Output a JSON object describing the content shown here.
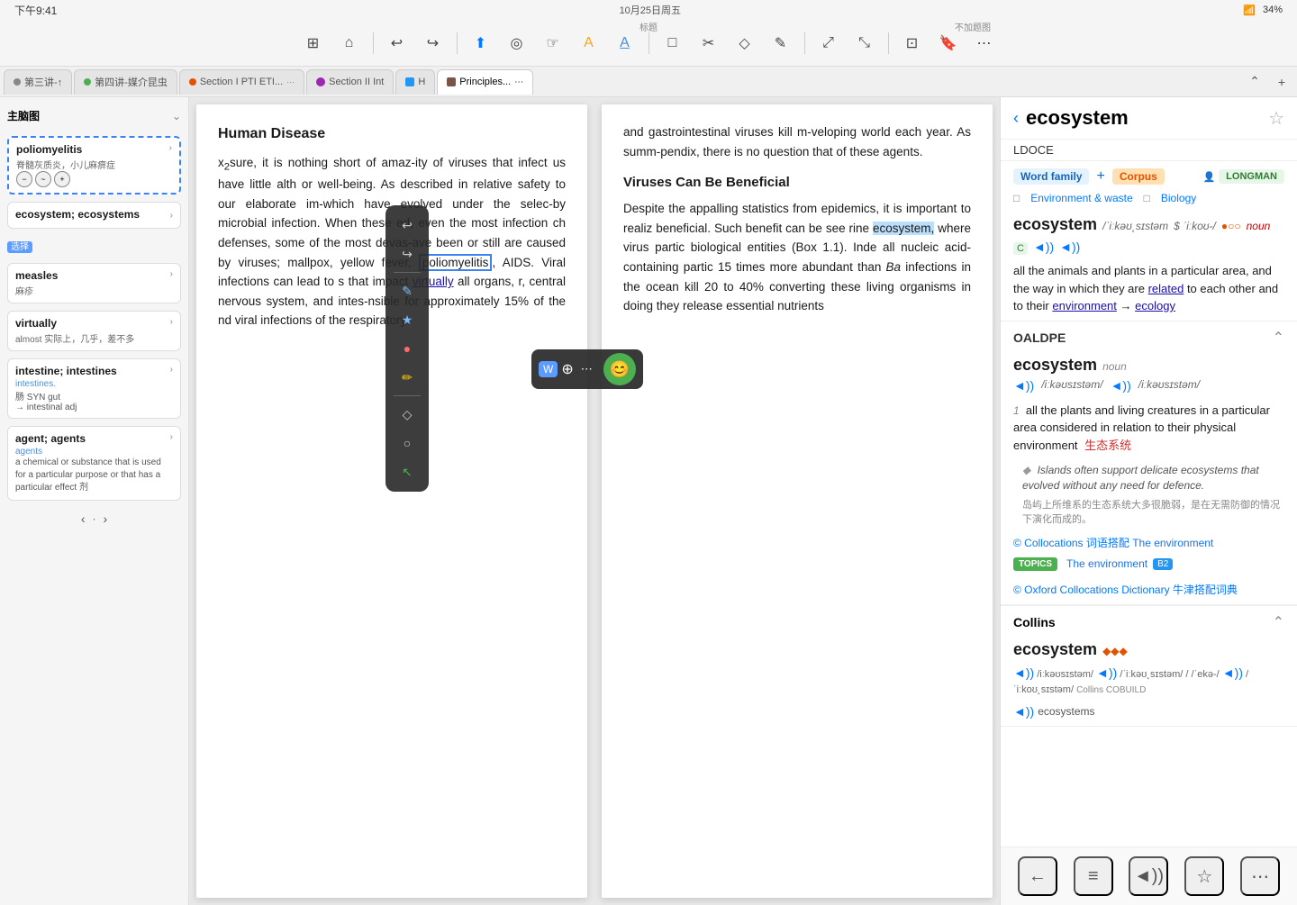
{
  "statusBar": {
    "time": "下午9:41",
    "date": "10月25日周五",
    "dots": "•••",
    "wifi": "WiFi",
    "signal": "34%"
  },
  "toolbar": {
    "buttons": [
      {
        "name": "sidebar-toggle",
        "icon": "⊞",
        "label": "Sidebar"
      },
      {
        "name": "home",
        "icon": "⌂",
        "label": "Home"
      },
      {
        "name": "undo",
        "icon": "↩",
        "label": "Undo"
      },
      {
        "name": "redo",
        "icon": "↪",
        "label": "Redo"
      },
      {
        "name": "share",
        "icon": "↑",
        "label": "Share"
      },
      {
        "name": "annotate",
        "icon": "◎",
        "label": "Annotate"
      },
      {
        "name": "hand",
        "icon": "☞",
        "label": "Hand"
      },
      {
        "name": "highlight",
        "icon": "A",
        "label": "Highlight"
      },
      {
        "name": "underline",
        "icon": "A̲",
        "label": "Underline"
      },
      {
        "name": "frame",
        "icon": "□",
        "label": "Frame"
      },
      {
        "name": "clip",
        "icon": "✂",
        "label": "Clip"
      },
      {
        "name": "comment",
        "icon": "♦",
        "label": "Comment"
      },
      {
        "name": "draw",
        "icon": "✎",
        "label": "Draw"
      },
      {
        "name": "zoom-in",
        "icon": "⤢",
        "label": "Zoom In"
      },
      {
        "name": "zoom-out",
        "icon": "⤡",
        "label": "Zoom Out"
      },
      {
        "name": "scan",
        "icon": "⊡",
        "label": "Scan"
      },
      {
        "name": "bookmark",
        "icon": "🔖",
        "label": "Bookmark"
      },
      {
        "name": "more",
        "icon": "⋯",
        "label": "More"
      }
    ],
    "label": "标题",
    "label2": "不加题图"
  },
  "tabs": [
    {
      "id": "tab1",
      "label": "第三讲-↑",
      "color": "#888",
      "active": false
    },
    {
      "id": "tab2",
      "label": "第四讲-媒介昆虫",
      "color": "#4caf50",
      "active": false
    },
    {
      "id": "tab3",
      "label": "Section I PTI ETI...",
      "color": "#e65100",
      "active": false
    },
    {
      "id": "tab4",
      "label": "Section II Int",
      "color": "#9c27b0",
      "active": false
    },
    {
      "id": "tab5",
      "label": "H",
      "color": "#2196f3",
      "active": false
    },
    {
      "id": "tab6",
      "label": "Principles...",
      "color": "#795548",
      "active": false
    }
  ],
  "floatToolbar": {
    "buttons": [
      {
        "name": "undo-float",
        "icon": "↩"
      },
      {
        "name": "redo-float",
        "icon": "↪"
      },
      {
        "name": "pen-float",
        "icon": "✎"
      },
      {
        "name": "star-float",
        "icon": "★"
      },
      {
        "name": "dot-float",
        "icon": "•"
      },
      {
        "name": "pen2-float",
        "icon": "✏"
      },
      {
        "name": "eraser-float",
        "icon": "⌫"
      },
      {
        "name": "circle-float",
        "icon": "○"
      },
      {
        "name": "cursor-float",
        "icon": "↖"
      }
    ]
  },
  "vocabPanel": {
    "title": "主脑图",
    "items": [
      {
        "title": "poliomyelitis",
        "subtitle": "脊髓灰质炎，小儿麻痹症",
        "highlighted": true,
        "buttons": [
          "−",
          "~",
          "+"
        ]
      },
      {
        "title": "ecosystem; ecosystems",
        "subtitle": "",
        "highlighted": false,
        "buttons": []
      },
      {
        "select": "选择"
      },
      {
        "title": "measles",
        "subtitle": "麻疹",
        "highlighted": false,
        "buttons": []
      },
      {
        "title": "virtually",
        "subtitle": "almost 实际上，几乎，差不多",
        "highlighted": false,
        "buttons": []
      },
      {
        "title": "intestine; intestines",
        "subtitle": "intestines.\n肠 SYN gut\n→ intestinal adj",
        "highlighted": false,
        "buttons": []
      },
      {
        "title": "agent; agents",
        "subtitle": "agents\na chemical or substance that is used for a particular purpose or that has a particular effect 剂",
        "highlighted": false,
        "buttons": []
      }
    ],
    "nav": "< >"
  },
  "docLeft": {
    "heading": "Human Disease",
    "paragraphs": [
      "sure, it is nothing short of amaz-ity of viruses that infect us have little alth or well-being. As described in relative safety to our elaborate im-which have evolved under the selec-by microbial infection. When these ed, even the most infection ch defenses, some of the most devas-ave been or still are caused by viruses; mallpox, yellow fever, poliomyelitis, AIDS. Viral infections can lead to s that impact virtually all organs, r, central nervous system, and intes-nsible for approximately 15% of the nd viral infections of the respiratory"
    ]
  },
  "docRight": {
    "paragraphs": [
      "and gastrointestinal viruses kill m- veloping world each year. As summ- pendix, there is no question that of these agents."
    ],
    "heading2": "Viruses Can Be Beneficial",
    "para2": "Despite the appalling statistics from epidemics, it is important to realiz beneficial. Such benefit can be see rine ecosystem, where virus partic biological entities (Box 1.1). Inde all nucleic acid-containing partic 15 times more abundant than Ba infections in the ocean kill 20 to 40% converting these living organisms in doing they release essential nutrients"
  },
  "textPopup": {
    "item1": "W⊕",
    "item2": "⋯"
  },
  "dictionary": {
    "title": "ecosystem",
    "source": "LDOCE",
    "backBtn": "‹",
    "starBtn": "☆",
    "sections": {
      "ldoce": {
        "wordFamilyLabel": "Word family",
        "plusLabel": "+",
        "corpusLabel": "Corpus",
        "longmanLabel": "LONGMAN",
        "categories": [
          "Environment & waste",
          "Biology"
        ],
        "mainWord": "ecosystem",
        "phonetic1": "/ˈiːkəʊ˛sɪstəm",
        "phonetic2": "$ ˈiːkoʊ-/",
        "dots": "●○○",
        "pos": "noun",
        "cefr": "C",
        "definition": "all the animals and plants in a particular area, and the way in which they are related to each other and to their environment → ecology",
        "ecologyLink": "ecology",
        "exampleEn": "Islands often support delicate ecosystems that evolved without any need for defence.",
        "exampleCn": "岛屿上所维系的生态系统大多很脆弱，是在无需防御的情况下演化而成的。",
        "collocationsLabel": "© Collocations 词语搭配 The environment",
        "topicsLabel": "TOPICS",
        "topicItem": "The environment",
        "topicBadge": "B2",
        "oxfordLabel": "© Oxford Collocations Dictionary 牛津搭配词典"
      },
      "oaldpe": {
        "title": "OALDPE",
        "word": "ecosystem",
        "pos": "noun",
        "phonetic1": "◄)) /iːkəʊsɪstəm/",
        "phonetic2": "◄)) /iːkəʊsɪstəm/",
        "defNumber": "1",
        "definition": "all the plants and living creatures in a particular area considered in relation to their physical environment",
        "defCn": "生态系统",
        "exampleEn": "Islands often support delicate ecosystems that evolved without any need for defence.",
        "exampleCn": "岛屿上所维系的生态系统大多很脆弱，是在无需防御的情况下演化而成的。",
        "collocationsLabel": "© Collocations 词语搭配 The environment",
        "topicsLabel": "TOPICS",
        "topicItem": "The environment",
        "topicBadge": "B2",
        "oxfordLabel": "© Oxford Collocations Dictionary 牛津搭配词典"
      },
      "collins": {
        "title": "Collins",
        "word": "ecosystem",
        "symbols": "◆◆◆",
        "phonetic1": "/iːkəʊsɪstəm/",
        "phonetic2": "◄)) /iːkəʊ˛sɪstəm/",
        "phonetic3": "/ˈiːkoʊ˛sɪstəm/",
        "phonetic4": "/ˈekə-/",
        "phonetic5": "/ˈiːkoʊ˛sɪstəm/",
        "brand": "Collins COBUILD",
        "plural": "ecosystems",
        "pluralIcon": "◄))"
      }
    },
    "bottomToolbar": {
      "backBtn": "←",
      "listBtn": "≡",
      "speakerBtn": "◄))",
      "starBtn": "☆",
      "moreBtn": "⋯"
    }
  }
}
